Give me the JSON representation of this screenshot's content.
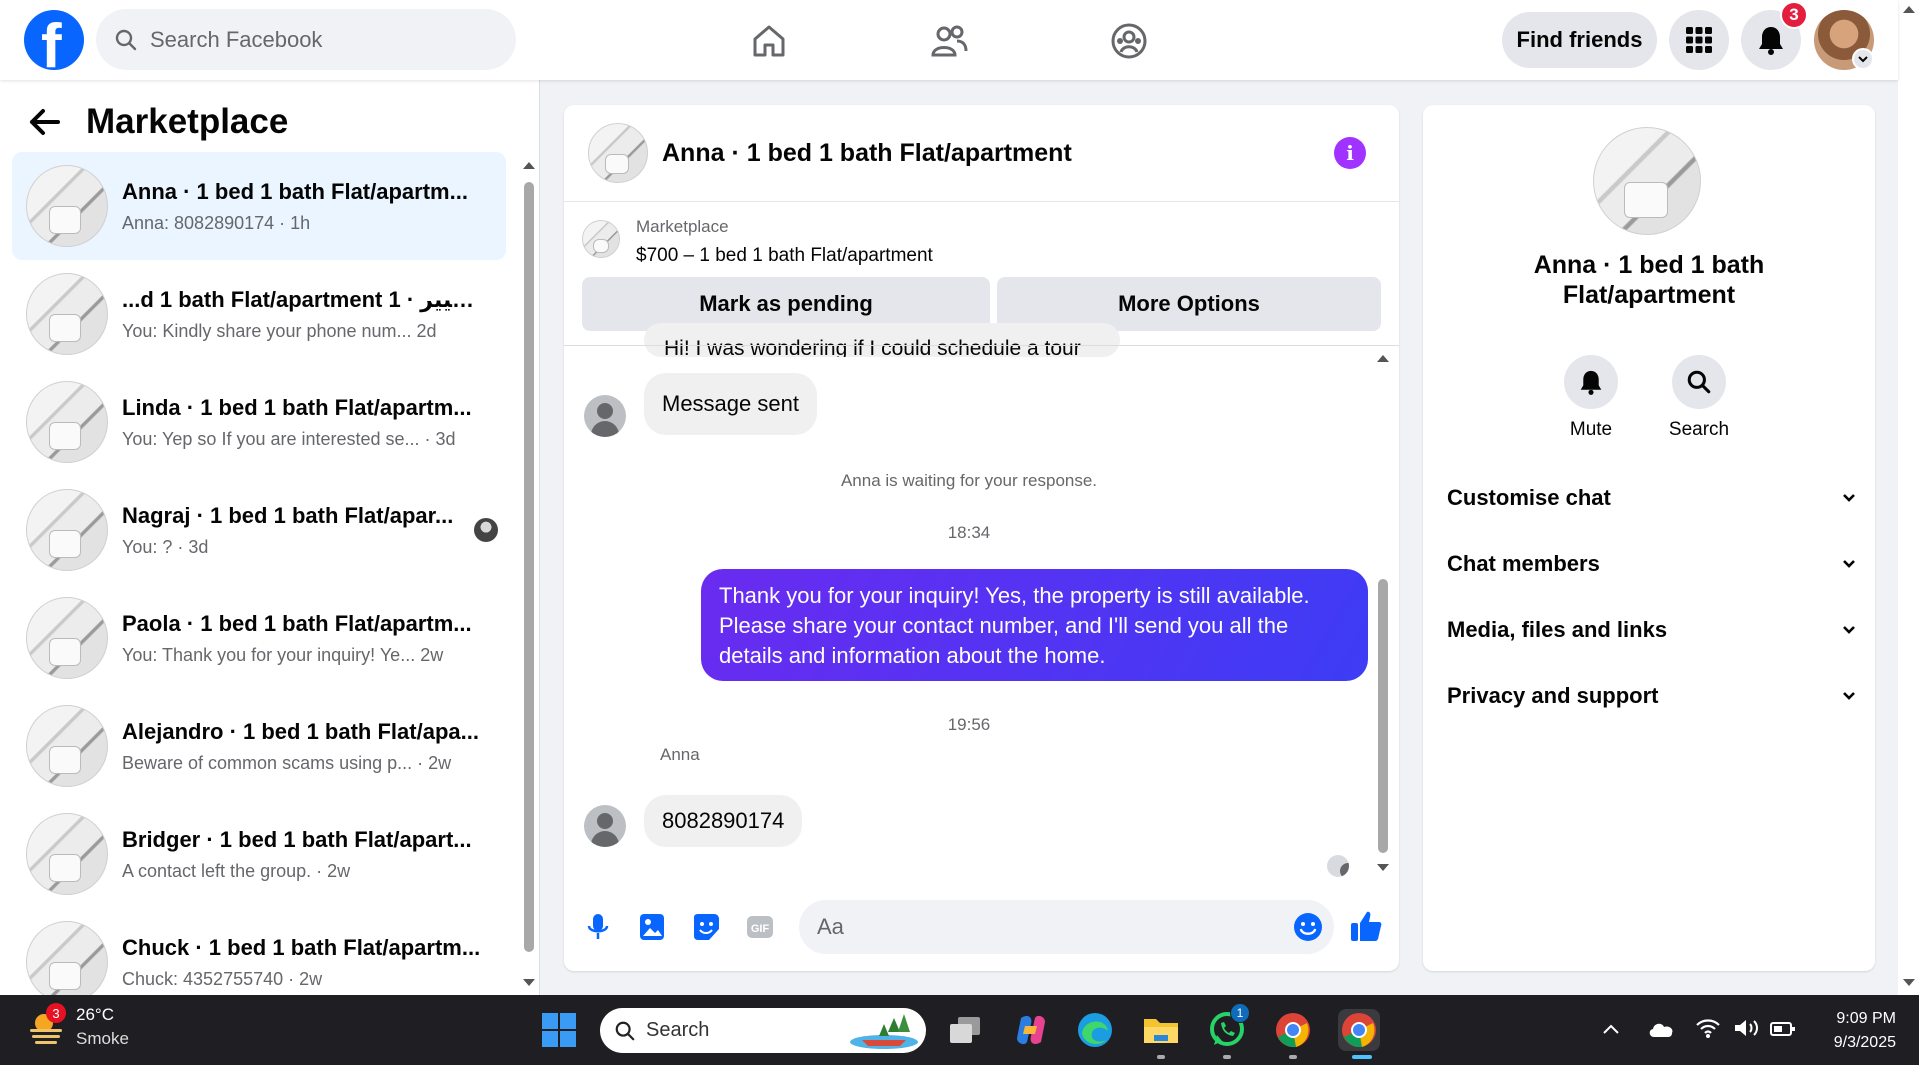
{
  "topbar": {
    "logo_letter": "f",
    "search_placeholder": "Search Facebook",
    "find_friends_label": "Find friends",
    "notification_count": "3"
  },
  "sidebar": {
    "title": "Marketplace",
    "conversations": [
      {
        "title": "Anna · 1 bed 1 bath Flat/apartm...",
        "subtitle": "Anna: 8082890174 · 1h",
        "active": true
      },
      {
        "title": "...d 1 bath Flat/apartment 1 · خافيير",
        "subtitle": "You: Kindly share your phone num...   2d",
        "active": false
      },
      {
        "title": "Linda · 1 bed 1 bath Flat/apartm...",
        "subtitle": "You: Yep so If you are interested se... · 3d",
        "active": false
      },
      {
        "title": "Nagraj · 1 bed 1 bath Flat/apar...",
        "subtitle": "You: ? · 3d",
        "active": false
      },
      {
        "title": "Paola · 1 bed 1 bath Flat/apartm...",
        "subtitle": "You: Thank you for your inquiry! Ye...   2w",
        "active": false
      },
      {
        "title": "Alejandro · 1 bed 1 bath Flat/apa...",
        "subtitle": "Beware of common scams using p... · 2w",
        "active": false
      },
      {
        "title": "Bridger · 1 bed 1 bath Flat/apart...",
        "subtitle": "A contact left the group. · 2w",
        "active": false
      },
      {
        "title": "Chuck · 1 bed 1 bath Flat/apartm...",
        "subtitle": "Chuck: 4352755740 · 2w",
        "active": false
      }
    ]
  },
  "chat": {
    "title": "Anna · 1 bed 1 bath Flat/apartment",
    "marketplace_label": "Marketplace",
    "listing": "$700 – 1 bed 1 bath Flat/apartment",
    "mark_pending_label": "Mark as pending",
    "more_options_label": "More Options",
    "cut_message": "Hi! I was wondering if I could schedule a tour",
    "message_sent": "Message sent",
    "waiting_note": "Anna is waiting for your response.",
    "time_1": "18:34",
    "outgoing_message": "Thank you for your inquiry! Yes, the property is still available. Please share your contact number, and I'll send you all the details and information about the home.",
    "time_2": "19:56",
    "sender_name": "Anna",
    "incoming_message": "8082890174",
    "composer_placeholder": "Aa"
  },
  "info_panel": {
    "name": "Anna · 1 bed 1 bath Flat/apartment",
    "mute_label": "Mute",
    "search_label": "Search",
    "sections": [
      "Customise chat",
      "Chat members",
      "Media, files and links",
      "Privacy and support"
    ]
  },
  "taskbar": {
    "weather_badge": "3",
    "temperature": "26°C",
    "condition": "Smoke",
    "search_placeholder": "Search",
    "whatsapp_badge": "1",
    "time": "9:09 PM",
    "date": "9/3/2025"
  },
  "colors": {
    "brand_blue": "#0866ff",
    "active_conversation": "#ebf5ff",
    "outgoing_bubble": "#5b2cf2",
    "info_button": "#a033ff",
    "notification_red": "#e41e3f"
  }
}
